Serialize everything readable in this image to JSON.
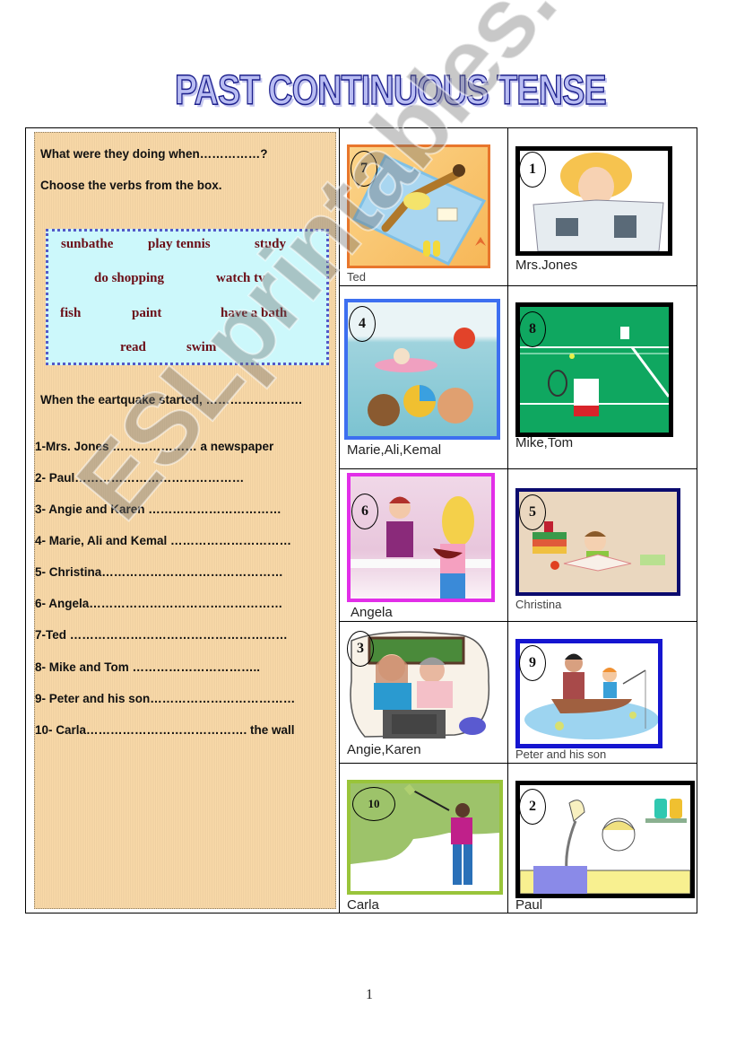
{
  "title": "PAST CONTINUOUS TENSE",
  "instructions": {
    "line1": "What were they doing when……………?",
    "line2": "Choose the verbs from the box."
  },
  "verb_box": {
    "verbs": [
      "sunbathe",
      "play tennis",
      "study",
      "do shopping",
      "watch tv",
      "fish",
      "paint",
      "have a bath",
      "read",
      "swim"
    ]
  },
  "prompt": "When the eartquake started, ……………………",
  "questions": [
    "1-Mrs. Jones ………………… a newspaper",
    "2- Paul……………………………………",
    "3- Angie and Karen ……………………………",
    "4- Marie, Ali and Kemal …………………………",
    "5- Christina………………………………………",
    "6- Angela…………………………………………",
    "7-Ted ………………………………………………",
    "8- Mike and Tom …………………………..",
    "9- Peter and his son………………………………",
    "10- Carla…………………………………. the wall"
  ],
  "pictures": [
    {
      "number": "7",
      "caption": "Ted",
      "scene": "man sunbathing on towel",
      "border_color": "#e8762c"
    },
    {
      "number": "1",
      "caption": "Mrs.Jones",
      "scene": "woman reading newspaper",
      "border_color": "#000000"
    },
    {
      "number": "4",
      "caption": "Marie,Ali,Kemal",
      "scene": "people swimming in pool",
      "border_color": "#3d6ff0"
    },
    {
      "number": "8",
      "caption": "Mike,Tom",
      "scene": "tennis players on court",
      "border_color": "#000000"
    },
    {
      "number": "6",
      "caption": "Angela",
      "scene": "women shopping at counter",
      "border_color": "#e22ee8"
    },
    {
      "number": "5",
      "caption": "Christina",
      "scene": "girl studying with books",
      "border_color": "#0b0b6e"
    },
    {
      "number": "3",
      "caption": "Angie,Karen",
      "scene": "women watching tv",
      "border_color": "none"
    },
    {
      "number": "9",
      "caption": "Peter and his son",
      "scene": "father and son fishing in boat",
      "border_color": "#1515d0"
    },
    {
      "number": "10",
      "caption": "Carla",
      "scene": "woman painting wall",
      "border_color": "#99c43a"
    },
    {
      "number": "2",
      "caption": "Paul",
      "scene": "man having a bath",
      "border_color": "#000000"
    }
  ],
  "watermark": "ESLprintables.com",
  "page_number": "1"
}
